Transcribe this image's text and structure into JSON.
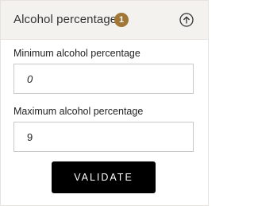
{
  "filter": {
    "title": "Alcohol percentage",
    "badge_count": "1",
    "toggle_icon": "chevron-up-circle-icon"
  },
  "min_field": {
    "label": "Minimum alcohol percentage",
    "value": "0"
  },
  "max_field": {
    "label": "Maximum alcohol percentage",
    "value": "9"
  },
  "actions": {
    "validate_label": "VALIDATE"
  },
  "colors": {
    "header_bg": "#f4f2ee",
    "badge": "#a07737",
    "button_bg": "#000000"
  }
}
